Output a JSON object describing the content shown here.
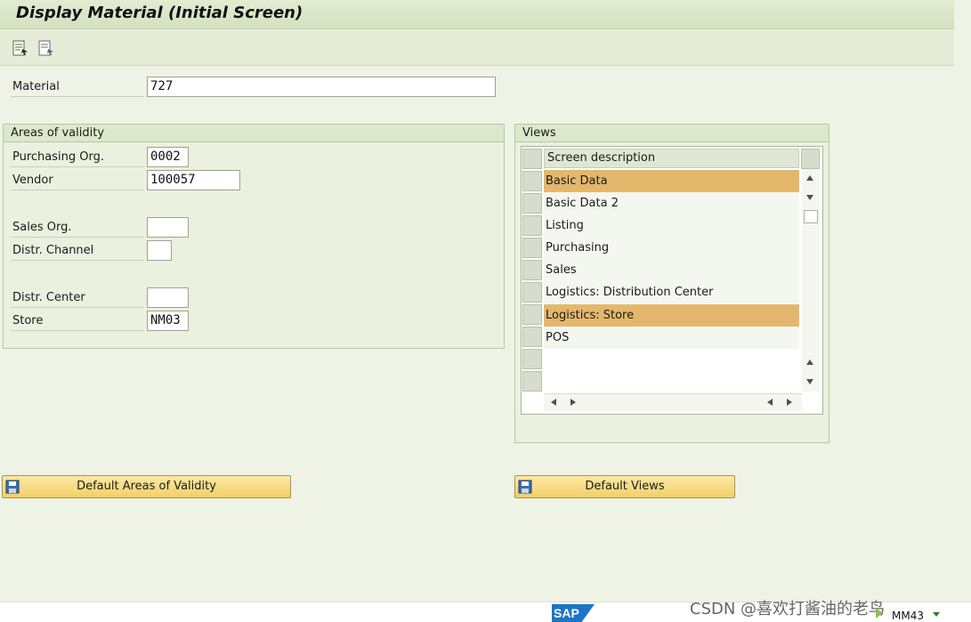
{
  "window": {
    "title": "Display Material (Initial Screen)"
  },
  "toolbar": {
    "buttons": [
      {
        "icon": "select-data-icon"
      },
      {
        "icon": "select-views-icon"
      }
    ]
  },
  "material": {
    "label": "Material",
    "value": "727"
  },
  "areas": {
    "title": "Areas of validity",
    "purchasing_org": {
      "label": "Purchasing Org.",
      "value": "0002"
    },
    "vendor": {
      "label": "Vendor",
      "value": "100057"
    },
    "sales_org": {
      "label": "Sales Org.",
      "value": ""
    },
    "distr_channel": {
      "label": "Distr. Channel",
      "value": ""
    },
    "distr_center": {
      "label": "Distr. Center",
      "value": ""
    },
    "store": {
      "label": "Store",
      "value": "NM03"
    }
  },
  "views": {
    "title": "Views",
    "column_header": "Screen description",
    "rows": [
      {
        "label": "Basic Data",
        "selected": true
      },
      {
        "label": "Basic Data 2",
        "selected": false
      },
      {
        "label": "Listing",
        "selected": false
      },
      {
        "label": "Purchasing",
        "selected": false
      },
      {
        "label": "Sales",
        "selected": false
      },
      {
        "label": "Logistics: Distribution Center",
        "selected": false
      },
      {
        "label": "Logistics: Store",
        "selected": true
      },
      {
        "label": "POS",
        "selected": false
      }
    ]
  },
  "buttons": {
    "default_areas": "Default Areas of Validity",
    "default_views": "Default Views"
  },
  "statusbar": {
    "sap_logo": "SAP",
    "transaction": "MM43",
    "watermark": "CSDN @喜欢打酱油的老鸟"
  },
  "colors": {
    "selected_row": "#e4b86c",
    "button_fill": "#f3cf6a",
    "background": "#eef3e6"
  }
}
